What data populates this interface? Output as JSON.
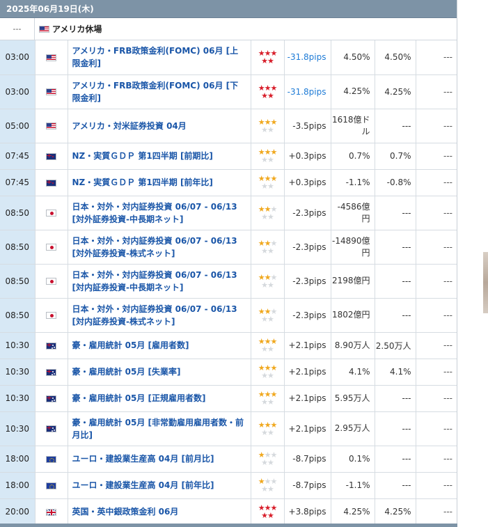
{
  "date_header": "2025年06月19日(木)",
  "holiday": {
    "time": "---",
    "name": "アメリカ休場",
    "flag_icon": "us-flag-icon"
  },
  "rows": [
    {
      "time": "03:00",
      "flag": "us",
      "name": "アメリカ・FRB政策金利(FOMC) 06月 [上限金利]",
      "stars": 5,
      "star_color": "red",
      "pips": "-31.8pips",
      "pips_blue": true,
      "forecast": "4.50%",
      "result": "4.50%",
      "extra": "---"
    },
    {
      "time": "03:00",
      "flag": "us",
      "name": "アメリカ・FRB政策金利(FOMC) 06月 [下限金利]",
      "stars": 5,
      "star_color": "red",
      "pips": "-31.8pips",
      "pips_blue": true,
      "forecast": "4.25%",
      "result": "4.25%",
      "extra": "---"
    },
    {
      "time": "05:00",
      "flag": "us",
      "name": "アメリカ・対米証券投資 04月",
      "stars": 3,
      "star_color": "gold",
      "pips": "-3.5pips",
      "pips_blue": false,
      "forecast": "1618億ドル",
      "result": "---",
      "extra": "---"
    },
    {
      "time": "07:45",
      "flag": "nz",
      "name": "NZ・実質ＧＤＰ 第1四半期 [前期比]",
      "stars": 3,
      "star_color": "gold",
      "pips": "+0.3pips",
      "pips_blue": false,
      "forecast": "0.7%",
      "result": "0.7%",
      "extra": "---"
    },
    {
      "time": "07:45",
      "flag": "nz",
      "name": "NZ・実質ＧＤＰ 第1四半期 [前年比]",
      "stars": 3,
      "star_color": "gold",
      "pips": "+0.3pips",
      "pips_blue": false,
      "forecast": "-1.1%",
      "result": "-0.8%",
      "extra": "---"
    },
    {
      "time": "08:50",
      "flag": "jp",
      "name": "日本・対外・対内証券投資 06/07 - 06/13 [対外証券投資-中長期ネット]",
      "stars": 2,
      "star_color": "gold",
      "pips": "-2.3pips",
      "pips_blue": false,
      "forecast": "-4586億円",
      "result": "---",
      "extra": "---"
    },
    {
      "time": "08:50",
      "flag": "jp",
      "name": "日本・対外・対内証券投資 06/07 - 06/13 [対外証券投資-株式ネット]",
      "stars": 2,
      "star_color": "gold",
      "pips": "-2.3pips",
      "pips_blue": false,
      "forecast": "-14890億円",
      "result": "---",
      "extra": "---"
    },
    {
      "time": "08:50",
      "flag": "jp",
      "name": "日本・対外・対内証券投資 06/07 - 06/13 [対内証券投資-中長期ネット]",
      "stars": 2,
      "star_color": "gold",
      "pips": "-2.3pips",
      "pips_blue": false,
      "forecast": "2198億円",
      "result": "---",
      "extra": "---"
    },
    {
      "time": "08:50",
      "flag": "jp",
      "name": "日本・対外・対内証券投資 06/07 - 06/13 [対内証券投資-株式ネット]",
      "stars": 2,
      "star_color": "gold",
      "pips": "-2.3pips",
      "pips_blue": false,
      "forecast": "1802億円",
      "result": "---",
      "extra": "---"
    },
    {
      "time": "10:30",
      "flag": "au",
      "name": "豪・雇用統計 05月 [雇用者数]",
      "stars": 3,
      "star_color": "gold",
      "pips": "+2.1pips",
      "pips_blue": false,
      "forecast": "8.90万人",
      "result": "2.50万人",
      "extra": "---"
    },
    {
      "time": "10:30",
      "flag": "au",
      "name": "豪・雇用統計 05月 [失業率]",
      "stars": 3,
      "star_color": "gold",
      "pips": "+2.1pips",
      "pips_blue": false,
      "forecast": "4.1%",
      "result": "4.1%",
      "extra": "---"
    },
    {
      "time": "10:30",
      "flag": "au",
      "name": "豪・雇用統計 05月 [正規雇用者数]",
      "stars": 3,
      "star_color": "gold",
      "pips": "+2.1pips",
      "pips_blue": false,
      "forecast": "5.95万人",
      "result": "---",
      "extra": "---"
    },
    {
      "time": "10:30",
      "flag": "au",
      "name": "豪・雇用統計 05月 [非常勤雇用雇用者数・前月比]",
      "stars": 3,
      "star_color": "gold",
      "pips": "+2.1pips",
      "pips_blue": false,
      "forecast": "2.95万人",
      "result": "---",
      "extra": "---"
    },
    {
      "time": "18:00",
      "flag": "eu",
      "name": "ユーロ・建設業生産高 04月 [前月比]",
      "stars": 1,
      "star_color": "gold",
      "pips": "-8.7pips",
      "pips_blue": false,
      "forecast": "0.1%",
      "result": "---",
      "extra": "---"
    },
    {
      "time": "18:00",
      "flag": "eu",
      "name": "ユーロ・建設業生産高 04月 [前年比]",
      "stars": 1,
      "star_color": "gold",
      "pips": "-8.7pips",
      "pips_blue": false,
      "forecast": "-1.1%",
      "result": "---",
      "extra": "---"
    },
    {
      "time": "20:00",
      "flag": "gb",
      "name": "英国・英中銀政策金利 06月",
      "stars": 5,
      "star_color": "red",
      "pips": "+3.8pips",
      "pips_blue": false,
      "forecast": "4.25%",
      "result": "4.25%",
      "extra": "---"
    }
  ],
  "colors": {
    "header_bg": "#7d93a6",
    "time_bg": "#d7e8f5",
    "name_text": "#1a56a8",
    "star_red": "#d81e2a",
    "star_gold": "#f0a81e",
    "pips_blue": "#1e7bd6"
  }
}
